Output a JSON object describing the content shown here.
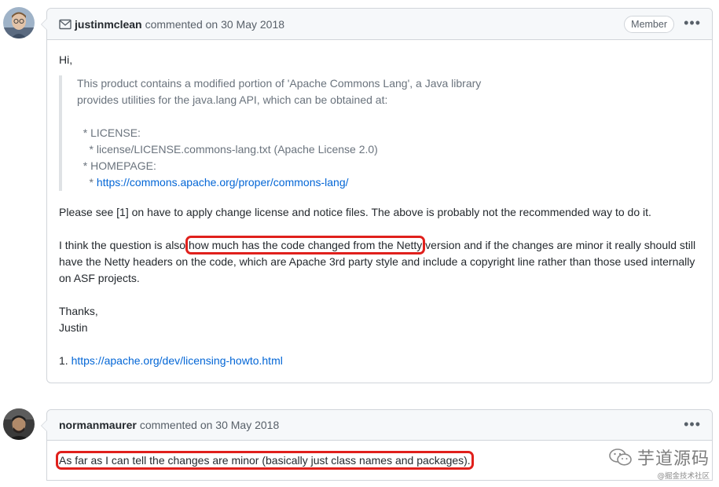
{
  "comments": [
    {
      "author": "justinmclean",
      "meta": "commented on 30 May 2018",
      "badge": "Member",
      "menu": "•••",
      "greeting": "Hi,",
      "quote_lines": [
        "This product contains a modified portion of 'Apache Commons Lang', a Java library",
        "provides utilities for the java.lang API, which can be obtained at:",
        "",
        "  * LICENSE:",
        "    * license/LICENSE.commons-lang.txt (Apache License 2.0)",
        "  * HOMEPAGE:",
        "    * "
      ],
      "quote_link": "https://commons.apache.org/proper/commons-lang/",
      "para1": "Please see [1] on have to apply change license and notice files. The above is probably not the recommended way to do it.",
      "para2_before": "I think the question is also ",
      "para2_highlight": "how much has the code changed from the Netty",
      "para2_after": " version and if the changes are minor it really should still have the Netty headers on the code, which are Apache 3rd party style and include a copyright line rather than those used internally on ASF projects.",
      "thanks": "Thanks,",
      "signature": "Justin",
      "footnote_prefix": "1. ",
      "footnote_link": "https://apache.org/dev/licensing-howto.html"
    },
    {
      "author": "normanmaurer",
      "meta": "commented on 30 May 2018",
      "menu": "•••",
      "body": "As far as I can tell the changes are minor (basically just class names and packages)."
    }
  ],
  "watermark": {
    "title": "芋道源码",
    "subtitle": "@掘金技术社区",
    "icon": "wechat-icon"
  },
  "colors": {
    "link": "#0366d6",
    "highlight": "#e0201c",
    "border": "#d1d5da"
  }
}
